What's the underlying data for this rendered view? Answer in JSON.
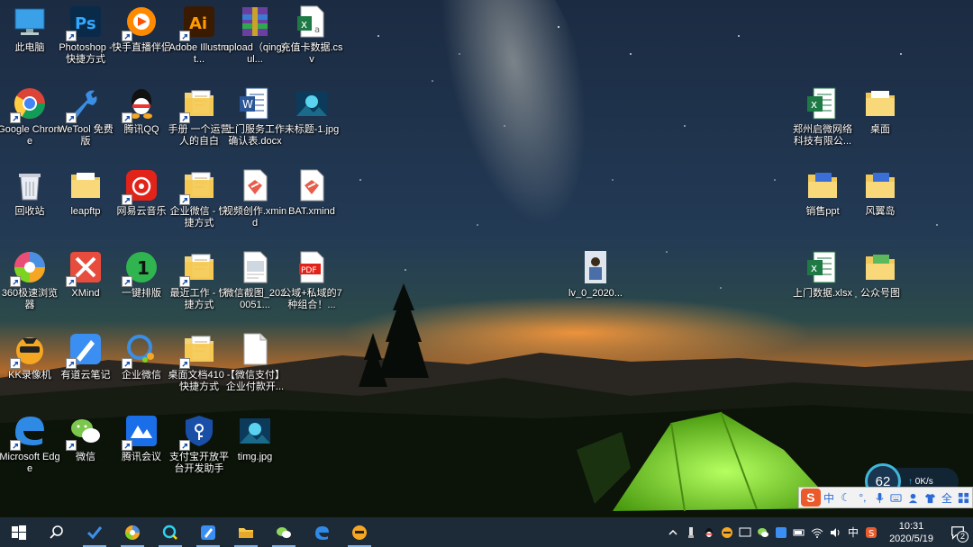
{
  "desktop": {
    "icons": [
      {
        "id": "this-pc",
        "label": "此电脑",
        "col": 0,
        "row": 0,
        "icon": "computer-icon",
        "shortcut": false
      },
      {
        "id": "photoshop",
        "label": "Photoshop - 快捷方式",
        "col": 1,
        "row": 0,
        "icon": "photoshop-icon",
        "shortcut": true
      },
      {
        "id": "kuaishou",
        "label": "快手直播伴侣",
        "col": 2,
        "row": 0,
        "icon": "kuaishou-icon",
        "shortcut": true
      },
      {
        "id": "illustrator",
        "label": "Adobe Illustrat...",
        "col": 3,
        "row": 0,
        "icon": "illustrator-icon",
        "shortcut": true
      },
      {
        "id": "upload-archive",
        "label": "upload（qingyul...",
        "col": 4,
        "row": 0,
        "icon": "archive-icon",
        "shortcut": false
      },
      {
        "id": "recharge-csv",
        "label": "充值卡数据.csv",
        "col": 5,
        "row": 0,
        "icon": "excel-csv-icon",
        "shortcut": false
      },
      {
        "id": "chrome",
        "label": "Google Chrome",
        "col": 0,
        "row": 1,
        "icon": "chrome-icon",
        "shortcut": true
      },
      {
        "id": "wetool",
        "label": "WeTool 免费版",
        "col": 1,
        "row": 1,
        "icon": "wetool-icon",
        "shortcut": true
      },
      {
        "id": "qq",
        "label": "腾讯QQ",
        "col": 2,
        "row": 1,
        "icon": "qq-icon",
        "shortcut": true
      },
      {
        "id": "manual-folder",
        "label": "手册 一个运营人的自白",
        "col": 3,
        "row": 1,
        "icon": "folder-shortcut-icon",
        "shortcut": true
      },
      {
        "id": "service-docx",
        "label": "上门服务工作确认表.docx",
        "col": 4,
        "row": 1,
        "icon": "word-icon",
        "shortcut": false
      },
      {
        "id": "untitled-jpg",
        "label": "未标题-1.jpg",
        "col": 5,
        "row": 1,
        "icon": "image-icon",
        "shortcut": false
      },
      {
        "id": "recycle-bin",
        "label": "回收站",
        "col": 0,
        "row": 2,
        "icon": "recycle-bin-icon",
        "shortcut": false
      },
      {
        "id": "leapftp",
        "label": "leapftp",
        "col": 1,
        "row": 2,
        "icon": "folder-icon",
        "shortcut": false
      },
      {
        "id": "netease-music",
        "label": "网易云音乐",
        "col": 2,
        "row": 2,
        "icon": "netease-music-icon",
        "shortcut": true
      },
      {
        "id": "wecom-shortcut",
        "label": "企业微信 - 快捷方式",
        "col": 3,
        "row": 2,
        "icon": "folder-shortcut-icon",
        "shortcut": true
      },
      {
        "id": "video-xmind",
        "label": "视频创作.xmind",
        "col": 4,
        "row": 2,
        "icon": "xmind-file-icon",
        "shortcut": false
      },
      {
        "id": "bat-xmind",
        "label": "BAT.xmind",
        "col": 5,
        "row": 2,
        "icon": "xmind-file-icon",
        "shortcut": false
      },
      {
        "id": "browser-360",
        "label": "360极速浏览器",
        "col": 0,
        "row": 3,
        "icon": "browser-360-icon",
        "shortcut": true
      },
      {
        "id": "xmind",
        "label": "XMind",
        "col": 1,
        "row": 3,
        "icon": "xmind-icon",
        "shortcut": true
      },
      {
        "id": "yijian-paiban",
        "label": "一键排版",
        "col": 2,
        "row": 3,
        "icon": "yijian-icon",
        "shortcut": true
      },
      {
        "id": "recent-work",
        "label": "最近工作 - 快捷方式",
        "col": 3,
        "row": 3,
        "icon": "folder-shortcut-icon",
        "shortcut": true
      },
      {
        "id": "wechat-screenshot",
        "label": "微信截图_2020051...",
        "col": 4,
        "row": 3,
        "icon": "screenshot-file-icon",
        "shortcut": false
      },
      {
        "id": "gongyu-pdf",
        "label": "公域+私域的7种组合！...",
        "col": 5,
        "row": 3,
        "icon": "pdf-icon",
        "shortcut": false
      },
      {
        "id": "kk-recorder",
        "label": "KK录像机",
        "col": 0,
        "row": 4,
        "icon": "kk-recorder-icon",
        "shortcut": true
      },
      {
        "id": "youdao-note",
        "label": "有道云笔记",
        "col": 1,
        "row": 4,
        "icon": "youdao-note-icon",
        "shortcut": true
      },
      {
        "id": "wecom",
        "label": "企业微信",
        "col": 2,
        "row": 4,
        "icon": "wecom-icon",
        "shortcut": true
      },
      {
        "id": "desktop-docs",
        "label": "桌面文档410 - 快捷方式",
        "col": 3,
        "row": 4,
        "icon": "folder-shortcut-icon",
        "shortcut": true
      },
      {
        "id": "wechat-pay",
        "label": "【微信支付】企业付款开...",
        "col": 4,
        "row": 4,
        "icon": "blank-file-icon",
        "shortcut": false
      },
      {
        "id": "edge",
        "label": "Microsoft Edge",
        "col": 0,
        "row": 5,
        "icon": "edge-icon",
        "shortcut": true
      },
      {
        "id": "wechat",
        "label": "微信",
        "col": 1,
        "row": 5,
        "icon": "wechat-icon",
        "shortcut": true
      },
      {
        "id": "tencent-meeting",
        "label": "腾讯会议",
        "col": 2,
        "row": 5,
        "icon": "tencent-meeting-icon",
        "shortcut": true
      },
      {
        "id": "alipay-helper",
        "label": "支付宝开放平台开发助手",
        "col": 3,
        "row": 5,
        "icon": "alipay-helper-icon",
        "shortcut": true
      },
      {
        "id": "timg-jpg",
        "label": "timg.jpg",
        "col": 4,
        "row": 5,
        "icon": "image-icon",
        "shortcut": false
      }
    ],
    "floating_icons": [
      {
        "id": "lv-video",
        "label": "lv_0_2020...",
        "icon": "video-thumb-icon"
      }
    ],
    "right_icons": [
      {
        "id": "zhengzhou-xlsx",
        "label": "郑州启微网络科技有限公...",
        "icon": "excel-icon"
      },
      {
        "id": "desktop-folder",
        "label": "桌面",
        "icon": "folder-icon"
      },
      {
        "id": "sales-ppt",
        "label": "销售ppt",
        "icon": "folder-blue-icon"
      },
      {
        "id": "fengyi-island",
        "label": "风翼岛",
        "icon": "folder-blue-icon"
      },
      {
        "id": "visit-xlsx",
        "label": "上门数据.xlsx",
        "icon": "excel-icon"
      },
      {
        "id": "official-account",
        "label": "公众号图",
        "icon": "folder-green-icon"
      }
    ]
  },
  "speed_widget": {
    "value": "62",
    "rate": "0K/s"
  },
  "ime_bar": {
    "lang": "中",
    "brand": "S"
  },
  "taskbar": {
    "pinned": [
      {
        "id": "start",
        "icon": "windows-start-icon"
      },
      {
        "id": "search",
        "icon": "search-icon"
      },
      {
        "id": "tasks",
        "icon": "checkmark-app-icon"
      },
      {
        "id": "browser360",
        "icon": "browser-360-icon"
      },
      {
        "id": "search-app",
        "icon": "search-app-icon"
      },
      {
        "id": "note",
        "icon": "youdao-note-icon"
      },
      {
        "id": "explorer",
        "icon": "file-explorer-icon"
      },
      {
        "id": "wechat",
        "icon": "wechat-icon"
      },
      {
        "id": "edge",
        "icon": "edge-icon"
      },
      {
        "id": "kk",
        "icon": "kk-recorder-icon"
      }
    ],
    "tray_lang": "中",
    "time": "10:31",
    "date": "2020/5/19",
    "notifications": "2"
  },
  "colors": {
    "taskbar": "#1d2a38",
    "accent": "#7fb3e8",
    "tent": "#7ed321"
  }
}
